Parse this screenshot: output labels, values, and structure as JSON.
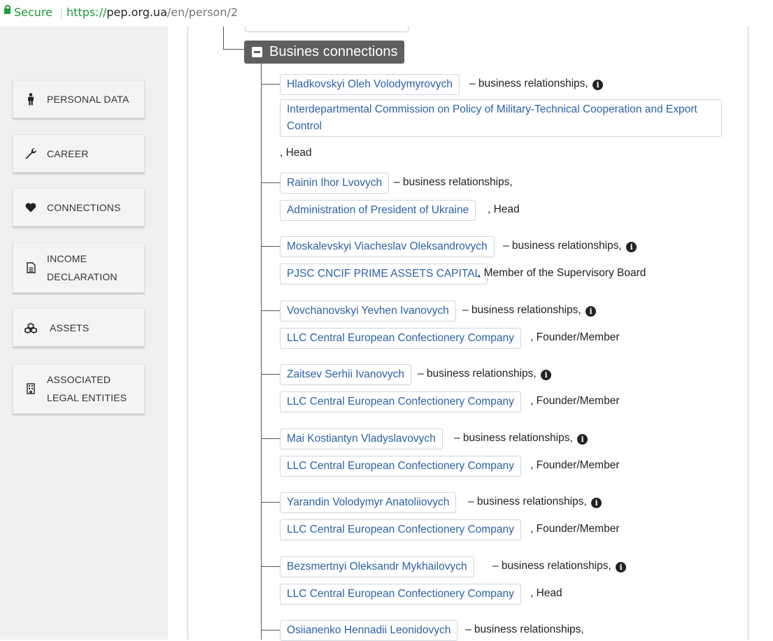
{
  "browser": {
    "secure_label": "Secure",
    "url_scheme": "https://",
    "url_host": "pep.org.ua",
    "url_path": "/en/person/2"
  },
  "sidebar": {
    "items": [
      {
        "label": "PERSONAL DATA",
        "icon": "person-icon"
      },
      {
        "label": "CAREER",
        "icon": "wrench-icon"
      },
      {
        "label": "CONNECTIONS",
        "icon": "heart-icon"
      },
      {
        "label": "INCOME\nDECLARATION",
        "icon": "document-icon"
      },
      {
        "label": "ASSETS",
        "icon": "cubes-icon"
      },
      {
        "label": "ASSOCIATED\nLEGAL ENTITIES",
        "icon": "building-icon"
      }
    ]
  },
  "section": {
    "title": "Busines connections"
  },
  "connections": [
    {
      "person": "Hladkovskyi Oleh Volodymyrovych",
      "relation": " – business relationships,",
      "info": true,
      "company": "Interdepartmental Commission on Policy of Military-Technical Cooperation and Export Control",
      "role": ", Head"
    },
    {
      "person": "Rainin Ihor Lvovych",
      "relation": " – business relationships,",
      "info": false,
      "company": "Administration of President of Ukraine",
      "role": ", Head"
    },
    {
      "person": "Moskalevskyi Viacheslav Oleksandrovych",
      "relation": " – business relationships,",
      "info": true,
      "company": "PJSC CNCIF PRIME ASSETS CAPITAL",
      "role": ", Member of the Supervisory Board"
    },
    {
      "person": "Vovchanovskyi Yevhen Ivanovych",
      "relation": " – business relationships,",
      "info": true,
      "company": "LLC Central European Confectionery Company",
      "role": ", Founder/Member"
    },
    {
      "person": "Zaitsev Serhii Ivanovych",
      "relation": " – business relationships,",
      "info": true,
      "company": "LLC Central European Confectionery Company",
      "role": ", Founder/Member"
    },
    {
      "person": "Mai Kostiantyn Vladyslavovych",
      "relation": " – business relationships,",
      "info": true,
      "company": "LLC Central European Confectionery Company",
      "role": ", Founder/Member"
    },
    {
      "person": "Yarandin Volodymyr Anatoliiovych",
      "relation": " – business relationships,",
      "info": true,
      "company": "LLC Central European Confectionery Company",
      "role": ", Founder/Member"
    },
    {
      "person": "Bezsmertnyi Oleksandr Mykhailovych",
      "relation": " – business relationships,",
      "info": true,
      "company": "LLC Central European Confectionery Company",
      "role": ", Head"
    },
    {
      "person": "Osiianenko Hennadii Leonidovych",
      "relation": " – business relationships,",
      "info": false,
      "company": "",
      "role": ""
    }
  ]
}
